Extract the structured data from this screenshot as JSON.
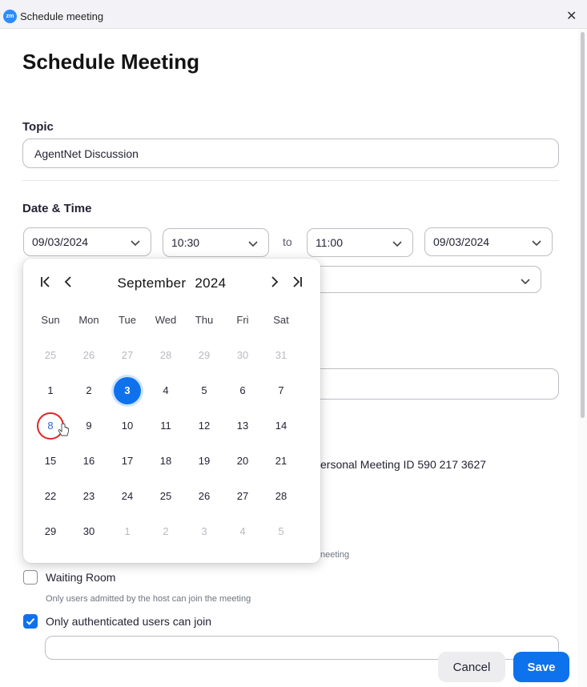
{
  "window": {
    "title": "Schedule meeting",
    "logo_text": "zm",
    "close_glyph": "✕"
  },
  "page": {
    "heading": "Schedule Meeting"
  },
  "topic": {
    "label": "Topic",
    "value": "AgentNet Discussion"
  },
  "datetime": {
    "label": "Date & Time",
    "start_date": "09/03/2024",
    "start_time": "10:30",
    "to_label": "to",
    "end_time": "11:00",
    "end_date": "09/03/2024"
  },
  "partially_hidden": {
    "meeting_id_text": "ersonal Meeting ID 590 217 3627",
    "meeting_hint_tail": "neeting"
  },
  "security": {
    "waiting_room_label": "Waiting Room",
    "waiting_room_checked": false,
    "waiting_room_hint": "Only users admitted by the host can join the meeting",
    "auth_label": "Only authenticated users can join",
    "auth_checked": true
  },
  "calendar": {
    "month": "September",
    "year": "2024",
    "weekdays": [
      "Sun",
      "Mon",
      "Tue",
      "Wed",
      "Thu",
      "Fri",
      "Sat"
    ],
    "weeks": [
      [
        "25",
        "26",
        "27",
        "28",
        "29",
        "30",
        "31"
      ],
      [
        "1",
        "2",
        "3",
        "4",
        "5",
        "6",
        "7"
      ],
      [
        "8",
        "9",
        "10",
        "11",
        "12",
        "13",
        "14"
      ],
      [
        "15",
        "16",
        "17",
        "18",
        "19",
        "20",
        "21"
      ],
      [
        "22",
        "23",
        "24",
        "25",
        "26",
        "27",
        "28"
      ],
      [
        "29",
        "30",
        "1",
        "2",
        "3",
        "4",
        "5"
      ]
    ],
    "outside_month": [
      [
        0,
        0
      ],
      [
        0,
        1
      ],
      [
        0,
        2
      ],
      [
        0,
        3
      ],
      [
        0,
        4
      ],
      [
        0,
        5
      ],
      [
        0,
        6
      ],
      [
        5,
        2
      ],
      [
        5,
        3
      ],
      [
        5,
        4
      ],
      [
        5,
        5
      ],
      [
        5,
        6
      ]
    ],
    "selected": [
      1,
      2
    ],
    "hovered": [
      2,
      0
    ]
  },
  "actions": {
    "cancel": "Cancel",
    "save": "Save"
  },
  "colors": {
    "accent": "#0e72ed",
    "hover_ring": "#e02424",
    "brand": "#2d8cff"
  }
}
